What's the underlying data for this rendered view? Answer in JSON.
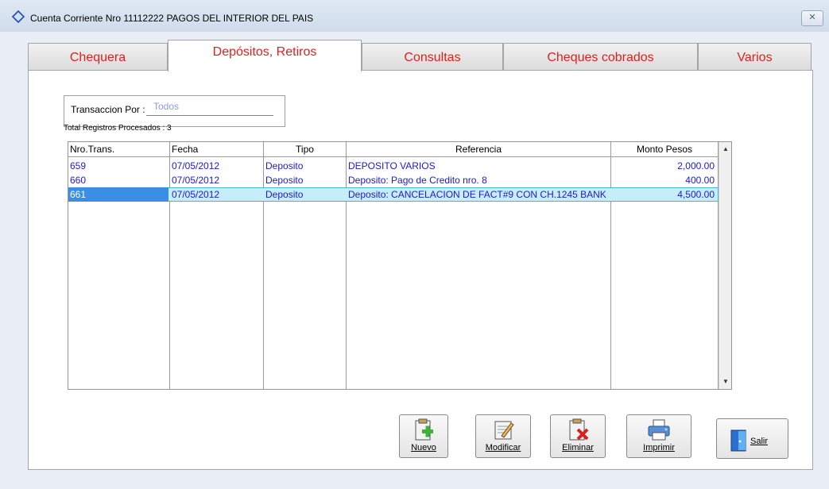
{
  "window": {
    "title": "Cuenta Corriente Nro 11112222 PAGOS DEL INTERIOR DEL PAIS",
    "close_glyph": "✕"
  },
  "tabs": [
    {
      "label": "Chequera"
    },
    {
      "label": "Depósitos, Retiros",
      "active": true
    },
    {
      "label": "Consultas"
    },
    {
      "label": "Cheques cobrados"
    },
    {
      "label": "Varios"
    }
  ],
  "filter": {
    "label": "Transaccion Por :",
    "value": "Todos"
  },
  "total": {
    "label": "Total Registros Procesados  : 3"
  },
  "grid": {
    "columns": [
      "Nro.Trans.",
      "Fecha",
      "Tipo",
      "Referencia",
      "Monto Pesos"
    ],
    "rows": [
      [
        "659",
        "07/05/2012",
        "Deposito",
        "DEPOSITO VARIOS",
        "2,000.00"
      ],
      [
        "660",
        "07/05/2012",
        "Deposito",
        "Deposito: Pago de Credito  nro. 8",
        "400.00"
      ],
      [
        "661",
        "07/05/2012",
        "Deposito",
        "Deposito: CANCELACION DE FACT#9 CON CH.1245 BANK",
        "4,500.00"
      ]
    ],
    "selected_row": 2,
    "scroll_up_glyph": "▲",
    "scroll_down_glyph": "▼"
  },
  "buttons": {
    "nuevo": "Nuevo",
    "modificar": "Modificar",
    "eliminar": "Eliminar",
    "imprimir": "Imprimir",
    "salir": "Salir"
  },
  "colors": {
    "tab_text": "#e0201d",
    "row_text": "#1a1ad8",
    "selection": "#c6eef8",
    "selection_cell": "#3a8ee6"
  }
}
